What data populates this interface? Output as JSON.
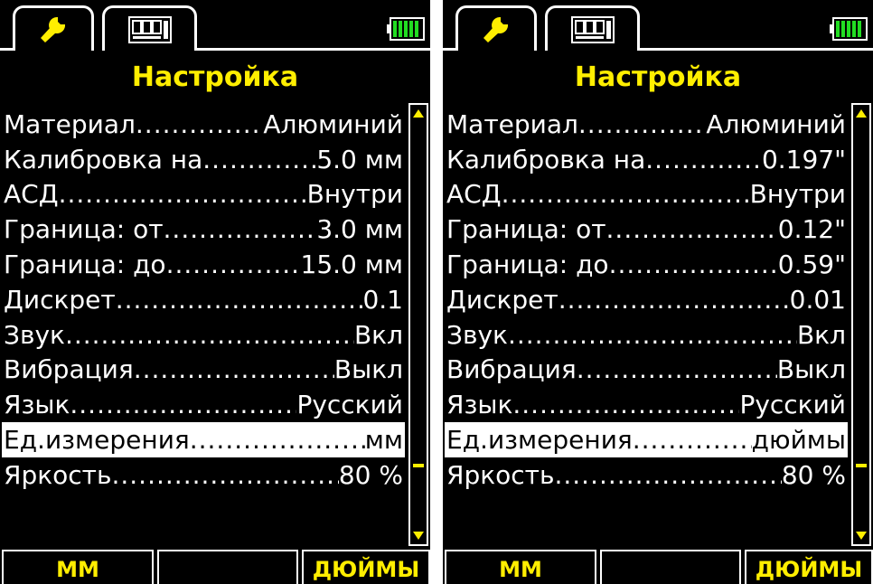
{
  "screens": [
    {
      "title": "Настройка",
      "menu": [
        {
          "label": "Материал",
          "value": "Алюминий"
        },
        {
          "label": "Калибровка на",
          "value": "5.0 мм"
        },
        {
          "label": "АСД",
          "value": "Внутри"
        },
        {
          "label": "Граница: от",
          "value": "3.0 мм"
        },
        {
          "label": "Граница: до",
          "value": "15.0 мм"
        },
        {
          "label": "Дискрет",
          "value": "0.1"
        },
        {
          "label": "Звук",
          "value": "Вкл"
        },
        {
          "label": "Вибрация",
          "value": "Выкл"
        },
        {
          "label": "Язык",
          "value": "Русский"
        },
        {
          "label": "Ед.измерения",
          "value": "мм"
        },
        {
          "label": "Яркость",
          "value": "80 %"
        }
      ],
      "selected_index": 9,
      "scroll_position": 0.85,
      "softkeys": {
        "left": "ММ",
        "center": "",
        "right": "ДЮЙМЫ"
      }
    },
    {
      "title": "Настройка",
      "menu": [
        {
          "label": "Материал",
          "value": "Алюминий"
        },
        {
          "label": "Калибровка на",
          "value": "0.197\""
        },
        {
          "label": "АСД",
          "value": "Внутри"
        },
        {
          "label": "Граница: от",
          "value": "0.12\""
        },
        {
          "label": "Граница: до",
          "value": "0.59\""
        },
        {
          "label": "Дискрет",
          "value": "0.01"
        },
        {
          "label": "Звук",
          "value": "Вкл"
        },
        {
          "label": "Вибрация",
          "value": "Выкл"
        },
        {
          "label": "Язык",
          "value": "Русский"
        },
        {
          "label": "Ед.измерения",
          "value": "дюймы"
        },
        {
          "label": "Яркость",
          "value": "80 %"
        }
      ],
      "selected_index": 9,
      "scroll_position": 0.85,
      "softkeys": {
        "left": "ММ",
        "center": "",
        "right": "ДЮЙМЫ"
      }
    }
  ],
  "icons": {
    "tab_settings": "wrench-icon",
    "tab_display": "digits-display-icon",
    "status": "battery-icon",
    "scroll_up": "arrow-up-icon",
    "scroll_down": "arrow-down-icon"
  },
  "colors": {
    "background": "#000000",
    "text": "#ffffff",
    "accent": "#ffee00",
    "battery": "#22dd22"
  }
}
